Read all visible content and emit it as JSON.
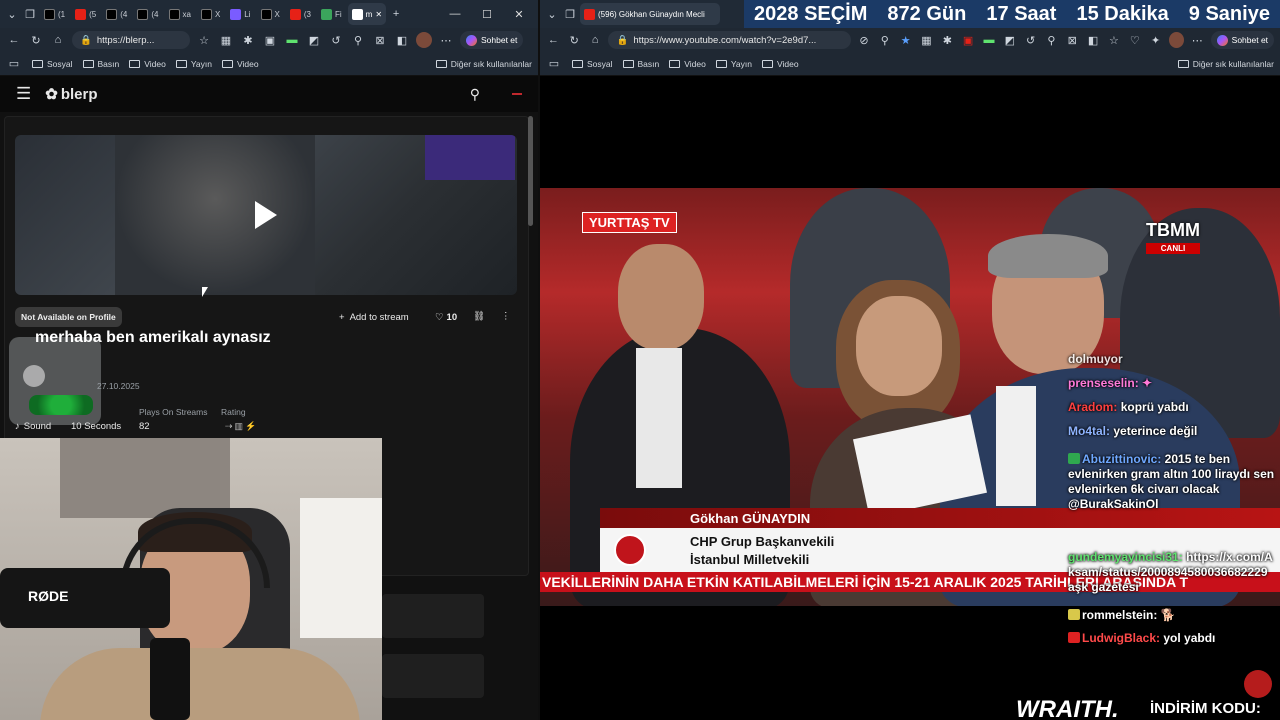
{
  "left_browser": {
    "tabs": [
      "(1",
      "(5",
      "(4",
      "(4",
      "xa",
      "X",
      "Li",
      "X",
      "(3",
      "Fi",
      "U"
    ],
    "active_tab": "m",
    "new_tab": "+",
    "url": "https://blerp...",
    "copilot_label": "Sohbet et",
    "bookmarks": [
      "Sosyal",
      "Basın",
      "Video",
      "Yayın",
      "Video"
    ],
    "bookmarks_other": "Diğer sık kullanılanlar"
  },
  "right_browser": {
    "active_tab": "(596) Gökhan Günaydın Mecli",
    "url": "https://www.youtube.com/watch?v=2e9d7...",
    "copilot_label": "Sohbet et",
    "bookmarks": [
      "Sosyal",
      "Basın",
      "Video",
      "Yayın",
      "Video"
    ],
    "bookmarks_other": "Diğer sık kullanılanlar"
  },
  "countdown": {
    "year": "2028",
    "label": "SEÇİM",
    "days": "872",
    "days_unit": "Gün",
    "hours": "17",
    "hours_unit": "Saat",
    "minutes": "15",
    "minutes_unit": "Dakika",
    "seconds": "9",
    "seconds_unit": "Saniye"
  },
  "blerp": {
    "logo": "blerp",
    "availability": "Not Available on Profile",
    "add_to_stream": "Add to stream",
    "likes": "10",
    "title": "merhaba ben amerikalı aynasız",
    "date": "27.10.2025",
    "stat_headers": [
      "Plays On Streams",
      "Rating"
    ],
    "type": "Sound",
    "duration": "10 Seconds",
    "plays": "82"
  },
  "video": {
    "channel": "YURTTAŞ TV",
    "tbmm": "TBMM",
    "tbmm_sub": "CANLI",
    "speaker": "Gökhan GÜNAYDIN",
    "role1": "CHP Grup Başkanvekili",
    "role2": "İstanbul Milletvekili",
    "ticker": "VEKİLLERİNİN DAHA ETKİN KATILABİLMELERİ İÇİN 15-21 ARALIK 2025 TARİHLERİ ARASINDA T"
  },
  "chat": [
    {
      "user": "dolmuyor",
      "msg": "",
      "color": "#ffffff"
    },
    {
      "user": "prenseselin:",
      "msg": "",
      "color": "#ff7ad9"
    },
    {
      "user": "Aradom:",
      "msg": "koprü yabdı",
      "color": "#ff4040"
    },
    {
      "user": "Mo4tal:",
      "msg": "yeterince değil",
      "color": "#8fb4ff"
    },
    {
      "user": "Abuzittinovic:",
      "msg": "2015 te ben evlenirken gram altın 100 liraydı sen evlenirken 6k civarı olacak @BurakSakinOl",
      "color": "#6fa8ff"
    },
    {
      "user": "gundemyayincisi31:",
      "msg": "https://x.com/Aksam/status/2000894580036682229 aşk gazetesi",
      "color": "#5fe36f"
    },
    {
      "user": "rommelstein:",
      "msg": "",
      "color": "#ffffff"
    },
    {
      "user": "LudwigBlack:",
      "msg": "yol yabdı",
      "color": "#ff4a4a"
    }
  ],
  "overlay": {
    "brand": "WRAITH.",
    "promo": "İNDİRİM KODU:",
    "mic_brand": "RØDE"
  }
}
